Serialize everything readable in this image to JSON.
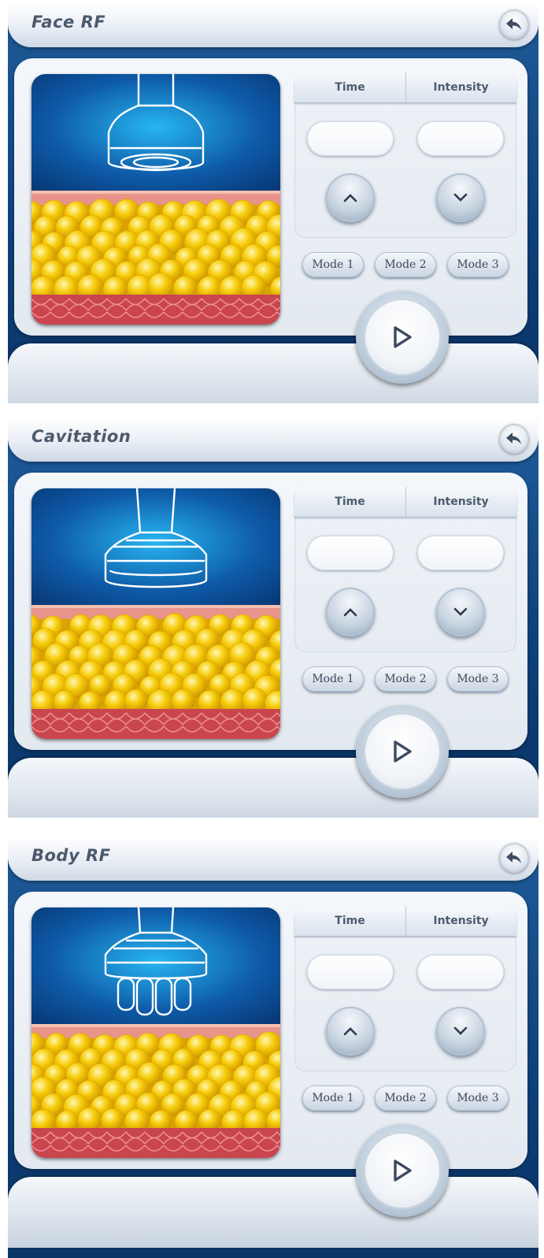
{
  "screens": [
    {
      "title": "Face RF",
      "tabs": {
        "time": "Time",
        "intensity": "Intensity"
      },
      "time_value": "",
      "intensity_value": "",
      "modes": [
        "Mode 1",
        "Mode 2",
        "Mode 3"
      ],
      "probe": "face-rf-probe-icon"
    },
    {
      "title": "Cavitation",
      "tabs": {
        "time": "Time",
        "intensity": "Intensity"
      },
      "time_value": "",
      "intensity_value": "",
      "modes": [
        "Mode 1",
        "Mode 2",
        "Mode 3"
      ],
      "probe": "cavitation-probe-icon"
    },
    {
      "title": "Body RF",
      "tabs": {
        "time": "Time",
        "intensity": "Intensity"
      },
      "time_value": "",
      "intensity_value": "",
      "modes": [
        "Mode 1",
        "Mode 2",
        "Mode 3"
      ],
      "probe": "body-rf-probe-icon"
    }
  ],
  "icons": {
    "back": "back-arrow-icon",
    "up": "chevron-up-icon",
    "down": "chevron-down-icon",
    "play": "play-icon"
  },
  "colors": {
    "background_blue": "#0d3f78",
    "panel": "#e9eef4",
    "fat_yellow": "#f2c200",
    "skin_pink": "#e8948a",
    "muscle_red": "#c9464f",
    "probe_glow": "#27b6f0"
  }
}
